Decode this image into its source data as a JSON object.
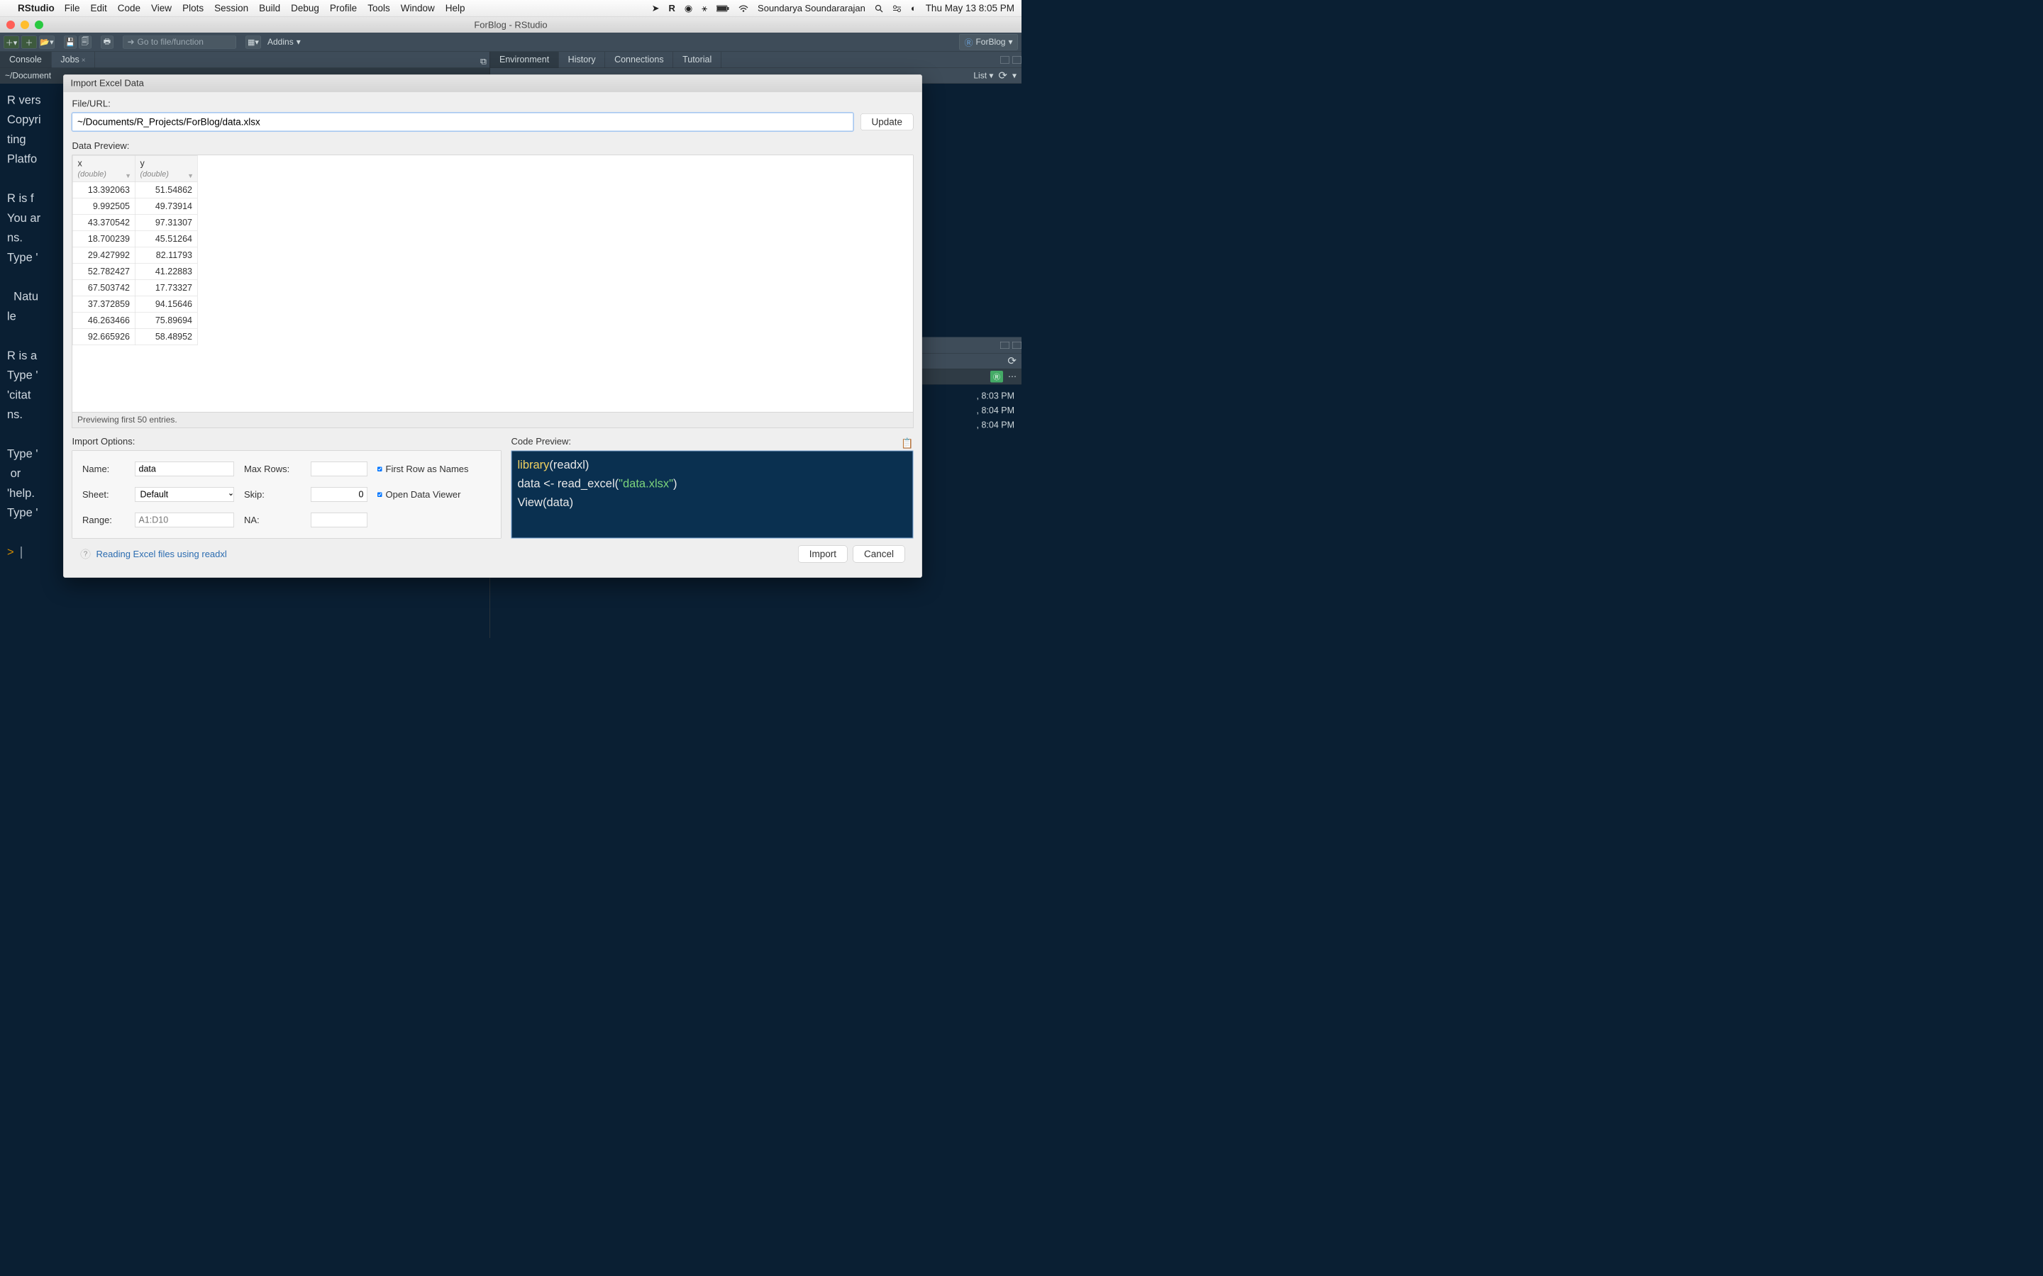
{
  "menubar": {
    "app": "RStudio",
    "items": [
      "File",
      "Edit",
      "Code",
      "View",
      "Plots",
      "Session",
      "Build",
      "Debug",
      "Profile",
      "Tools",
      "Window",
      "Help"
    ],
    "user": "Soundarya Soundararajan",
    "clock": "Thu May 13  8:05 PM"
  },
  "titlebar": {
    "title": "ForBlog - RStudio"
  },
  "toolbar": {
    "goto_placeholder": "Go to file/function",
    "addins": "Addins",
    "project": "ForBlog"
  },
  "left_tabs": {
    "console": "Console",
    "jobs": "Jobs"
  },
  "right_tabs": {
    "env": "Environment",
    "history": "History",
    "conn": "Connections",
    "tutorial": "Tutorial"
  },
  "right_sub": {
    "list": "List"
  },
  "console_path": "~/Document",
  "console_text": "R vers\nCopyri\nting\nPlatfo\n\nR is f\nYou ar\nns.\nType '\n\n  Natu\nle\n\nR is a\nType '\n'citat\nns.\n\nType '\n or\n'help.\nType '",
  "times": [
    ", 8:03 PM",
    ", 8:04 PM",
    ", 8:04 PM"
  ],
  "dialog": {
    "title": "Import Excel Data",
    "file_label": "File/URL:",
    "file_value": "~/Documents/R_Projects/ForBlog/data.xlsx",
    "update": "Update",
    "preview_label": "Data Preview:",
    "columns": [
      {
        "name": "x",
        "type": "(double)"
      },
      {
        "name": "y",
        "type": "(double)"
      }
    ],
    "rows": [
      [
        "13.392063",
        "51.54862"
      ],
      [
        "9.992505",
        "49.73914"
      ],
      [
        "43.370542",
        "97.31307"
      ],
      [
        "18.700239",
        "45.51264"
      ],
      [
        "29.427992",
        "82.11793"
      ],
      [
        "52.782427",
        "41.22883"
      ],
      [
        "67.503742",
        "17.73327"
      ],
      [
        "37.372859",
        "94.15646"
      ],
      [
        "46.263466",
        "75.89694"
      ],
      [
        "92.665926",
        "58.48952"
      ]
    ],
    "preview_footer": "Previewing first 50 entries.",
    "options_title": "Import Options:",
    "opt": {
      "name_l": "Name:",
      "name_v": "data",
      "max_l": "Max Rows:",
      "max_v": "",
      "sheet_l": "Sheet:",
      "sheet_v": "Default",
      "skip_l": "Skip:",
      "skip_v": "0",
      "range_l": "Range:",
      "range_ph": "A1:D10",
      "na_l": "NA:",
      "na_v": "",
      "first_row": "First Row as Names",
      "open_viewer": "Open Data Viewer"
    },
    "code_title": "Code Preview:",
    "code_lines": {
      "l1a": "library",
      "l1b": "(readxl)",
      "l2a": "data <- read_excel(",
      "l2b": "\"data.xlsx\"",
      "l2c": ")",
      "l3": "View(data)"
    },
    "help": "Reading Excel files using readxl",
    "import": "Import",
    "cancel": "Cancel"
  }
}
